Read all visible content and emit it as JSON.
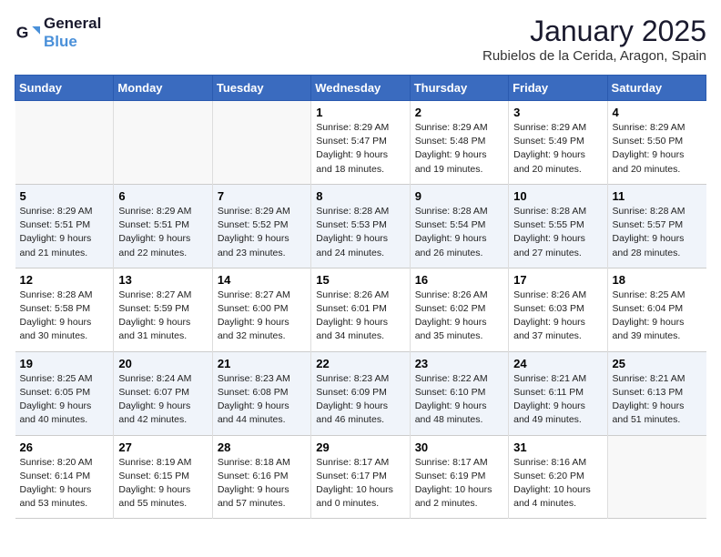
{
  "logo": {
    "line1": "General",
    "line2": "Blue"
  },
  "title": "January 2025",
  "subtitle": "Rubielos de la Cerida, Aragon, Spain",
  "days_header": [
    "Sunday",
    "Monday",
    "Tuesday",
    "Wednesday",
    "Thursday",
    "Friday",
    "Saturday"
  ],
  "weeks": [
    [
      {
        "day": "",
        "sunrise": "",
        "sunset": "",
        "daylight": ""
      },
      {
        "day": "",
        "sunrise": "",
        "sunset": "",
        "daylight": ""
      },
      {
        "day": "",
        "sunrise": "",
        "sunset": "",
        "daylight": ""
      },
      {
        "day": "1",
        "sunrise": "Sunrise: 8:29 AM",
        "sunset": "Sunset: 5:47 PM",
        "daylight": "Daylight: 9 hours and 18 minutes."
      },
      {
        "day": "2",
        "sunrise": "Sunrise: 8:29 AM",
        "sunset": "Sunset: 5:48 PM",
        "daylight": "Daylight: 9 hours and 19 minutes."
      },
      {
        "day": "3",
        "sunrise": "Sunrise: 8:29 AM",
        "sunset": "Sunset: 5:49 PM",
        "daylight": "Daylight: 9 hours and 20 minutes."
      },
      {
        "day": "4",
        "sunrise": "Sunrise: 8:29 AM",
        "sunset": "Sunset: 5:50 PM",
        "daylight": "Daylight: 9 hours and 20 minutes."
      }
    ],
    [
      {
        "day": "5",
        "sunrise": "Sunrise: 8:29 AM",
        "sunset": "Sunset: 5:51 PM",
        "daylight": "Daylight: 9 hours and 21 minutes."
      },
      {
        "day": "6",
        "sunrise": "Sunrise: 8:29 AM",
        "sunset": "Sunset: 5:51 PM",
        "daylight": "Daylight: 9 hours and 22 minutes."
      },
      {
        "day": "7",
        "sunrise": "Sunrise: 8:29 AM",
        "sunset": "Sunset: 5:52 PM",
        "daylight": "Daylight: 9 hours and 23 minutes."
      },
      {
        "day": "8",
        "sunrise": "Sunrise: 8:28 AM",
        "sunset": "Sunset: 5:53 PM",
        "daylight": "Daylight: 9 hours and 24 minutes."
      },
      {
        "day": "9",
        "sunrise": "Sunrise: 8:28 AM",
        "sunset": "Sunset: 5:54 PM",
        "daylight": "Daylight: 9 hours and 26 minutes."
      },
      {
        "day": "10",
        "sunrise": "Sunrise: 8:28 AM",
        "sunset": "Sunset: 5:55 PM",
        "daylight": "Daylight: 9 hours and 27 minutes."
      },
      {
        "day": "11",
        "sunrise": "Sunrise: 8:28 AM",
        "sunset": "Sunset: 5:57 PM",
        "daylight": "Daylight: 9 hours and 28 minutes."
      }
    ],
    [
      {
        "day": "12",
        "sunrise": "Sunrise: 8:28 AM",
        "sunset": "Sunset: 5:58 PM",
        "daylight": "Daylight: 9 hours and 30 minutes."
      },
      {
        "day": "13",
        "sunrise": "Sunrise: 8:27 AM",
        "sunset": "Sunset: 5:59 PM",
        "daylight": "Daylight: 9 hours and 31 minutes."
      },
      {
        "day": "14",
        "sunrise": "Sunrise: 8:27 AM",
        "sunset": "Sunset: 6:00 PM",
        "daylight": "Daylight: 9 hours and 32 minutes."
      },
      {
        "day": "15",
        "sunrise": "Sunrise: 8:26 AM",
        "sunset": "Sunset: 6:01 PM",
        "daylight": "Daylight: 9 hours and 34 minutes."
      },
      {
        "day": "16",
        "sunrise": "Sunrise: 8:26 AM",
        "sunset": "Sunset: 6:02 PM",
        "daylight": "Daylight: 9 hours and 35 minutes."
      },
      {
        "day": "17",
        "sunrise": "Sunrise: 8:26 AM",
        "sunset": "Sunset: 6:03 PM",
        "daylight": "Daylight: 9 hours and 37 minutes."
      },
      {
        "day": "18",
        "sunrise": "Sunrise: 8:25 AM",
        "sunset": "Sunset: 6:04 PM",
        "daylight": "Daylight: 9 hours and 39 minutes."
      }
    ],
    [
      {
        "day": "19",
        "sunrise": "Sunrise: 8:25 AM",
        "sunset": "Sunset: 6:05 PM",
        "daylight": "Daylight: 9 hours and 40 minutes."
      },
      {
        "day": "20",
        "sunrise": "Sunrise: 8:24 AM",
        "sunset": "Sunset: 6:07 PM",
        "daylight": "Daylight: 9 hours and 42 minutes."
      },
      {
        "day": "21",
        "sunrise": "Sunrise: 8:23 AM",
        "sunset": "Sunset: 6:08 PM",
        "daylight": "Daylight: 9 hours and 44 minutes."
      },
      {
        "day": "22",
        "sunrise": "Sunrise: 8:23 AM",
        "sunset": "Sunset: 6:09 PM",
        "daylight": "Daylight: 9 hours and 46 minutes."
      },
      {
        "day": "23",
        "sunrise": "Sunrise: 8:22 AM",
        "sunset": "Sunset: 6:10 PM",
        "daylight": "Daylight: 9 hours and 48 minutes."
      },
      {
        "day": "24",
        "sunrise": "Sunrise: 8:21 AM",
        "sunset": "Sunset: 6:11 PM",
        "daylight": "Daylight: 9 hours and 49 minutes."
      },
      {
        "day": "25",
        "sunrise": "Sunrise: 8:21 AM",
        "sunset": "Sunset: 6:13 PM",
        "daylight": "Daylight: 9 hours and 51 minutes."
      }
    ],
    [
      {
        "day": "26",
        "sunrise": "Sunrise: 8:20 AM",
        "sunset": "Sunset: 6:14 PM",
        "daylight": "Daylight: 9 hours and 53 minutes."
      },
      {
        "day": "27",
        "sunrise": "Sunrise: 8:19 AM",
        "sunset": "Sunset: 6:15 PM",
        "daylight": "Daylight: 9 hours and 55 minutes."
      },
      {
        "day": "28",
        "sunrise": "Sunrise: 8:18 AM",
        "sunset": "Sunset: 6:16 PM",
        "daylight": "Daylight: 9 hours and 57 minutes."
      },
      {
        "day": "29",
        "sunrise": "Sunrise: 8:17 AM",
        "sunset": "Sunset: 6:17 PM",
        "daylight": "Daylight: 10 hours and 0 minutes."
      },
      {
        "day": "30",
        "sunrise": "Sunrise: 8:17 AM",
        "sunset": "Sunset: 6:19 PM",
        "daylight": "Daylight: 10 hours and 2 minutes."
      },
      {
        "day": "31",
        "sunrise": "Sunrise: 8:16 AM",
        "sunset": "Sunset: 6:20 PM",
        "daylight": "Daylight: 10 hours and 4 minutes."
      },
      {
        "day": "",
        "sunrise": "",
        "sunset": "",
        "daylight": ""
      }
    ]
  ]
}
